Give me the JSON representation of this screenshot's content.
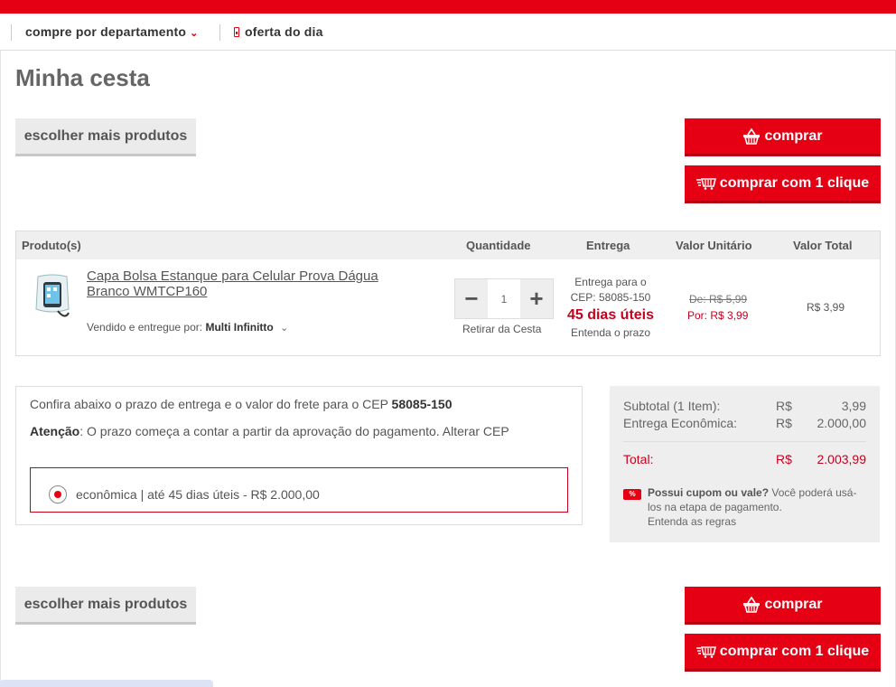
{
  "nav": {
    "departments": "compre por departamento",
    "deal": "oferta do dia"
  },
  "page": {
    "title": "Minha cesta"
  },
  "buttons": {
    "more_products": "escolher mais produtos",
    "buy": "comprar",
    "buy_one_click": "comprar com 1 clique"
  },
  "table": {
    "headers": [
      "Produto(s)",
      "Quantidade",
      "Entrega",
      "Valor Unitário",
      "Valor Total"
    ],
    "item": {
      "name": "Capa Bolsa Estanque para Celular Prova Dágua Branco WMTCP160",
      "seller_label": "Vendido e entregue por:",
      "seller": "Multi Infinitto",
      "quantity": "1",
      "remove": "Retirar da Cesta",
      "ship_line1": "Entrega para o",
      "ship_line2": "CEP: 58085-150",
      "ship_days": "45 dias úteis",
      "ship_link": "Entenda o prazo",
      "price_old": "De: R$ 5,99",
      "price_new": "Por: R$ 3,99",
      "price_total": "R$ 3,99"
    }
  },
  "shipping": {
    "info_prefix": "Confira abaixo o prazo de entrega e o valor do frete para o CEP",
    "cep": "58085-150",
    "attention_label": "Atenção",
    "attention_text": ": O prazo começa a contar a partir da aprovação do pagamento. Alterar CEP",
    "option": "econômica | até 45 dias úteis - R$ 2.000,00"
  },
  "summary": {
    "subtotal_label": "Subtotal (1 Item):",
    "subtotal_cur": "R$",
    "subtotal_val": "3,99",
    "delivery_label": "Entrega Econômica:",
    "delivery_cur": "R$",
    "delivery_val": "2.000,00",
    "total_label": "Total:",
    "total_cur": "R$",
    "total_val": "2.003,99",
    "coupon_tag": "%",
    "coupon_bold": "Possui cupom ou vale?",
    "coupon_text": "Você poderá usá-los na etapa de pagamento.",
    "coupon_link": "Entenda as regras"
  },
  "colors": {
    "brand_red": "#e60014",
    "price_red": "#c8001e"
  }
}
